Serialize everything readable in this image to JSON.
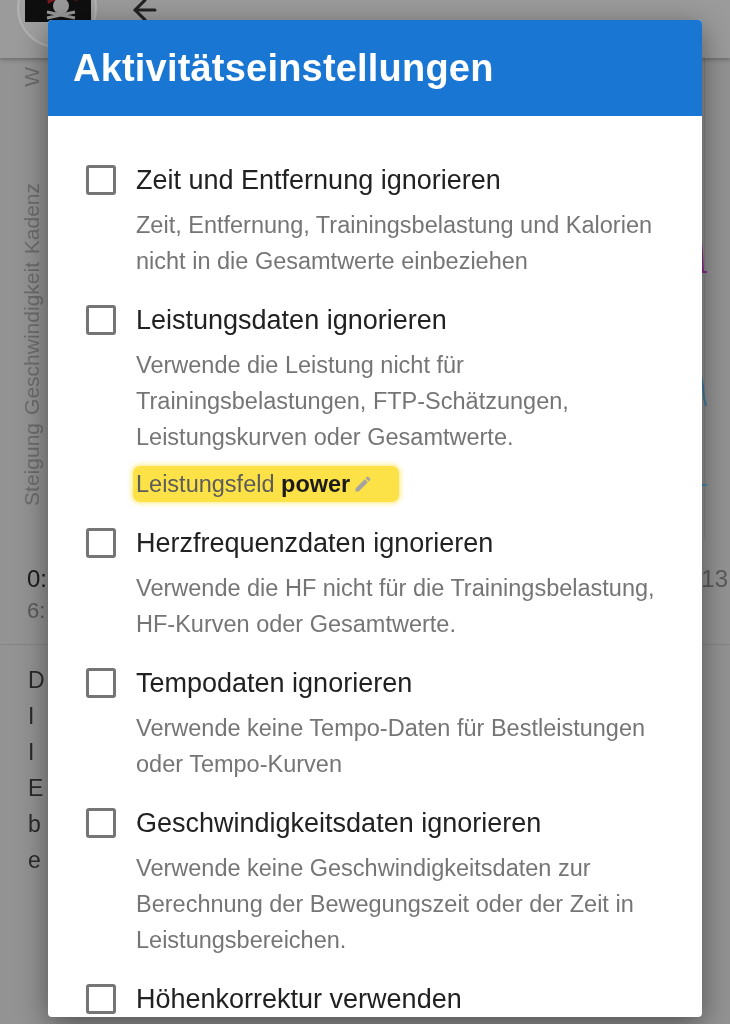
{
  "background": {
    "chart": {
      "top_label": "W",
      "axis_labels": [
        "Steigung",
        "Geschwindigkeit",
        "Kadenz"
      ]
    },
    "summary": {
      "left_values": [
        "0:",
        "6:"
      ],
      "right_value": "13"
    },
    "paragraph_lines": [
      "D",
      "I",
      "I",
      "E",
      "b",
      "e"
    ]
  },
  "dialog": {
    "title": "Aktivitätseinstellungen",
    "items": [
      {
        "label": "Zeit und Entfernung ignorieren",
        "checked": false,
        "description": "Zeit, Entfernung, Trainingsbelastung und Kalorien nicht in die Gesamtwerte einbeziehen"
      },
      {
        "label": "Leistungsdaten ignorieren",
        "checked": false,
        "description": "Verwende die Leistung nicht für Trainingsbelastungen, FTP-Schätzungen, Leistungskurven oder Gesamtwerte.",
        "field": {
          "text": "Leistungsfeld **power**",
          "highlighted": true
        }
      },
      {
        "label": "Herzfrequenzdaten ignorieren",
        "checked": false,
        "description": "Verwende die HF nicht für die Trainingsbelastung, HF-Kurven oder Gesamtwerte."
      },
      {
        "label": "Tempodaten ignorieren",
        "checked": false,
        "description": "Verwende keine Tempo-Daten für Bestleistungen oder Tempo-Kurven"
      },
      {
        "label": "Geschwindigkeitsdaten ignorieren",
        "checked": false,
        "description": "Verwende keine Geschwindigkeitsdaten zur Berechnung der Bewegungszeit oder der Zeit in Leistungsbereichen."
      },
      {
        "label": "Höhenkorrektur verwenden",
        "checked": false
      }
    ]
  }
}
